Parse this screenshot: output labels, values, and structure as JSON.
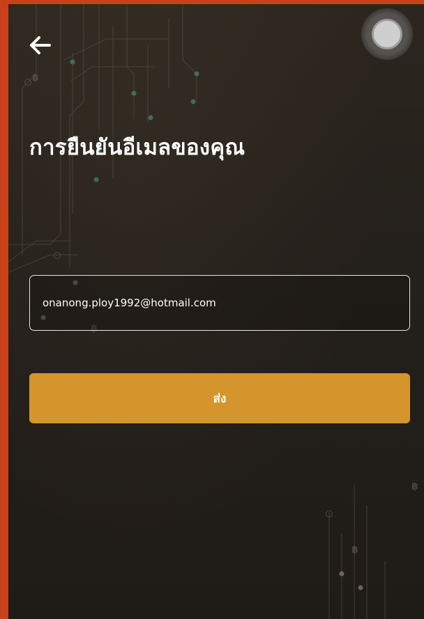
{
  "header": {
    "back_icon": "arrow-left-icon",
    "assistive_icon": "assistive-touch-icon"
  },
  "page": {
    "title": "การยืนยันอีเมลของคุณ"
  },
  "form": {
    "email_value": "onanong.ploy1992@hotmail.com",
    "submit_label": "ส่ง"
  },
  "colors": {
    "accent": "#d3952c",
    "frame_border": "#c8411c",
    "background": "#26211b",
    "text": "#ffffff"
  }
}
